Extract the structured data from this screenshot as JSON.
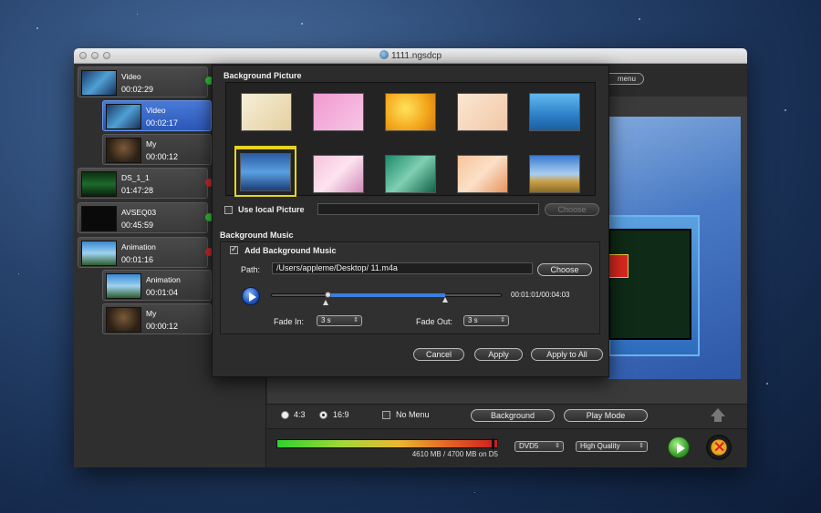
{
  "window": {
    "title": "1111.ngsdcp"
  },
  "sidebar": {
    "items": [
      {
        "title": "Video",
        "time": "00:02:29",
        "status": "green"
      },
      {
        "title": "Video",
        "time": "00:02:17",
        "selected": true
      },
      {
        "title": "My",
        "time": "00:00:12"
      },
      {
        "title": "DS_1_1",
        "time": "01:47:28",
        "status": "red"
      },
      {
        "title": "AVSEQ03",
        "time": "00:45:59",
        "status": "green"
      },
      {
        "title": "Animation",
        "time": "00:01:16",
        "status": "red"
      },
      {
        "title": "Animation",
        "time": "00:01:04"
      },
      {
        "title": "My",
        "time": "00:00:12"
      }
    ]
  },
  "topbar": {
    "menu_button": "menu"
  },
  "dialog": {
    "bg_picture_label": "Background Picture",
    "use_local_label": "Use local Picture",
    "local_path": "",
    "choose_picture": "Choose",
    "bg_music_label": "Background Music",
    "add_music_label": "Add Background Music",
    "add_music_checked": true,
    "path_label": "Path:",
    "path_value": "/Users/appleme/Desktop/ 11.m4a",
    "choose_music": "Choose",
    "time_display": "00:01:01/00:04:03",
    "fade_in_label": "Fade In:",
    "fade_in_value": "3 s",
    "fade_out_label": "Fade Out:",
    "fade_out_value": "3 s",
    "cancel": "Cancel",
    "apply": "Apply",
    "apply_all": "Apply to All"
  },
  "controls": {
    "ratio_43": "4:3",
    "ratio_169": "16:9",
    "selected_ratio": "16:9",
    "no_menu": "No Menu",
    "background_btn": "Background",
    "play_mode_btn": "Play Mode"
  },
  "status": {
    "capacity_text": "4610 MB / 4700 MB on D5",
    "capacity_fraction": 0.981,
    "disc_type": "DVD5",
    "quality": "High Quality"
  },
  "colors": {
    "selection_blue": "#2b57b8",
    "highlight_yellow": "#e5d324",
    "status_green": "#33c533",
    "status_red": "#d32a2a"
  }
}
